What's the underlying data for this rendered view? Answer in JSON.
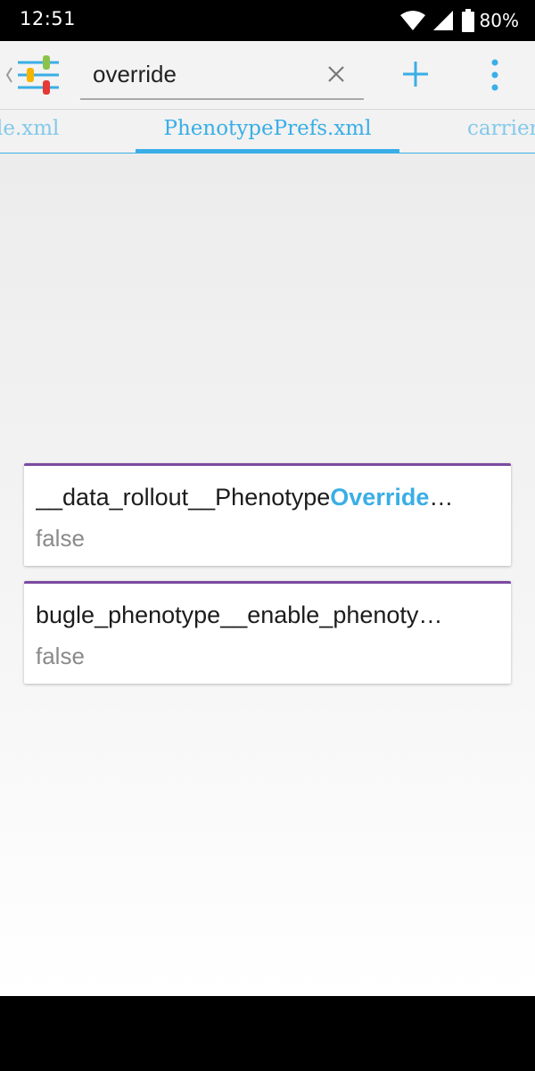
{
  "status_bar": {
    "time": "12:51",
    "battery_percent": "80%",
    "icons": [
      "wifi-icon",
      "cellular-signal-icon",
      "battery-icon"
    ]
  },
  "toolbar": {
    "logo_icon": "sliders-icon",
    "search": {
      "value": "override",
      "placeholder": ""
    },
    "clear_icon": "close-icon",
    "add_icon": "plus-icon",
    "menu_icon": "more-vert-icon"
  },
  "tabs": {
    "left_partial": "le.xml",
    "active": "PhenotypePrefs.xml",
    "right_partial": "carrier"
  },
  "results": [
    {
      "key_prefix": "__data_rollout__Phenotype",
      "key_match": "Override",
      "key_suffix": "…",
      "value": "false"
    },
    {
      "key_prefix": "bugle_phenotype__enable_phenoty",
      "key_match": "",
      "key_suffix": "…",
      "value": "false"
    }
  ],
  "colors": {
    "accent": "#3aaee6",
    "card_border": "#7b4aa0",
    "value_text": "#8a8a8a"
  }
}
